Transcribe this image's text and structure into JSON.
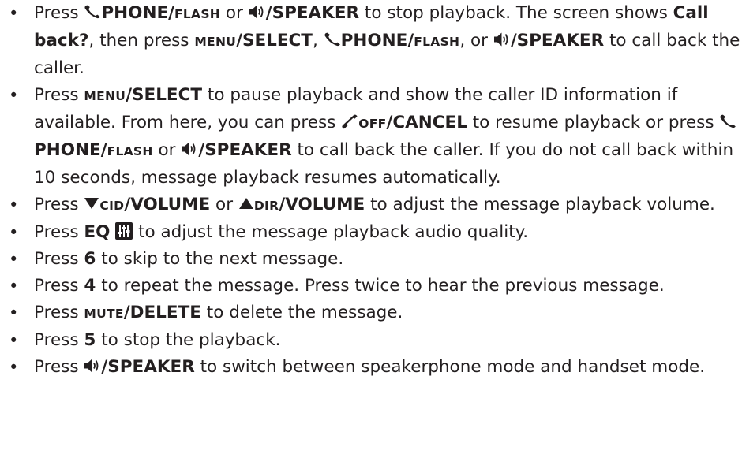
{
  "items": [
    {
      "segments": [
        {
          "t": "Press ",
          "s": "n"
        },
        {
          "icon": "phone-icon"
        },
        {
          "t": "PHONE/",
          "s": "k"
        },
        {
          "t": "FLASH",
          "s": "sc"
        },
        {
          "t": " or ",
          "s": "n"
        },
        {
          "icon": "speaker-icon"
        },
        {
          "t": "/SPEAKER",
          "s": "k"
        },
        {
          "t": " to stop playback. The screen shows ",
          "s": "n"
        },
        {
          "t": "Call back?",
          "s": "k"
        },
        {
          "t": ", then press ",
          "s": "n"
        },
        {
          "t": "MENU",
          "s": "sc"
        },
        {
          "t": "/SELECT",
          "s": "k"
        },
        {
          "t": ", ",
          "s": "n"
        },
        {
          "icon": "phone-icon"
        },
        {
          "t": "PHONE/",
          "s": "k"
        },
        {
          "t": "FLASH",
          "s": "sc"
        },
        {
          "t": ", or ",
          "s": "n"
        },
        {
          "icon": "speaker-icon"
        },
        {
          "t": "/SPEAKER",
          "s": "k"
        },
        {
          "t": " to call back the caller.",
          "s": "n"
        }
      ]
    },
    {
      "segments": [
        {
          "t": "Press ",
          "s": "n"
        },
        {
          "t": "MENU",
          "s": "sc"
        },
        {
          "t": "/SELECT",
          "s": "k"
        },
        {
          "t": " to pause playback and show the caller ID information if available. From here, you can press ",
          "s": "n"
        },
        {
          "icon": "hangup-icon"
        },
        {
          "t": "OFF",
          "s": "sc"
        },
        {
          "t": "/CANCEL",
          "s": "k"
        },
        {
          "t": " to resume playback or press ",
          "s": "n"
        },
        {
          "icon": "phone-icon"
        },
        {
          "t": "PHONE/",
          "s": "k"
        },
        {
          "t": "FLASH",
          "s": "sc"
        },
        {
          "t": "  or ",
          "s": "n"
        },
        {
          "icon": "speaker-icon"
        },
        {
          "t": "/SPEAKER",
          "s": "k"
        },
        {
          "t": " to call back the caller. If you do not call back within 10 seconds, message playback resumes automatically.",
          "s": "n"
        }
      ]
    },
    {
      "segments": [
        {
          "t": "Press ",
          "s": "n"
        },
        {
          "icon": "down-triangle-icon"
        },
        {
          "t": "CID",
          "s": "sc"
        },
        {
          "t": "/VOLUME",
          "s": "k"
        },
        {
          "t": " or ",
          "s": "n"
        },
        {
          "icon": "up-triangle-icon"
        },
        {
          "t": "DIR",
          "s": "sc"
        },
        {
          "t": "/VOLUME",
          "s": "k"
        },
        {
          "t": " to adjust the message playback volume.",
          "s": "n"
        }
      ]
    },
    {
      "segments": [
        {
          "t": "Press ",
          "s": "n"
        },
        {
          "t": "EQ",
          "s": "k"
        },
        {
          "t": " ",
          "s": "n"
        },
        {
          "icon": "equalizer-icon"
        },
        {
          "t": " to adjust the message playback audio quality.",
          "s": "n"
        }
      ]
    },
    {
      "segments": [
        {
          "t": "Press ",
          "s": "n"
        },
        {
          "t": "6",
          "s": "k"
        },
        {
          "t": " to skip to the next message.",
          "s": "n"
        }
      ]
    },
    {
      "segments": [
        {
          "t": "Press ",
          "s": "n"
        },
        {
          "t": "4",
          "s": "k"
        },
        {
          "t": " to repeat the message. Press twice to hear the previous message.",
          "s": "n"
        }
      ]
    },
    {
      "segments": [
        {
          "t": "Press ",
          "s": "n"
        },
        {
          "t": "MUTE",
          "s": "sc"
        },
        {
          "t": "/DELETE",
          "s": "k"
        },
        {
          "t": " to delete the message.",
          "s": "n"
        }
      ]
    },
    {
      "segments": [
        {
          "t": "Press ",
          "s": "n"
        },
        {
          "t": "5",
          "s": "k"
        },
        {
          "t": " to stop the playback.",
          "s": "n"
        }
      ]
    },
    {
      "segments": [
        {
          "t": "Press ",
          "s": "n"
        },
        {
          "icon": "speaker-icon"
        },
        {
          "t": "/SPEAKER",
          "s": "k"
        },
        {
          "t": " to switch between speakerphone mode and handset mode.",
          "s": "n"
        }
      ]
    }
  ]
}
